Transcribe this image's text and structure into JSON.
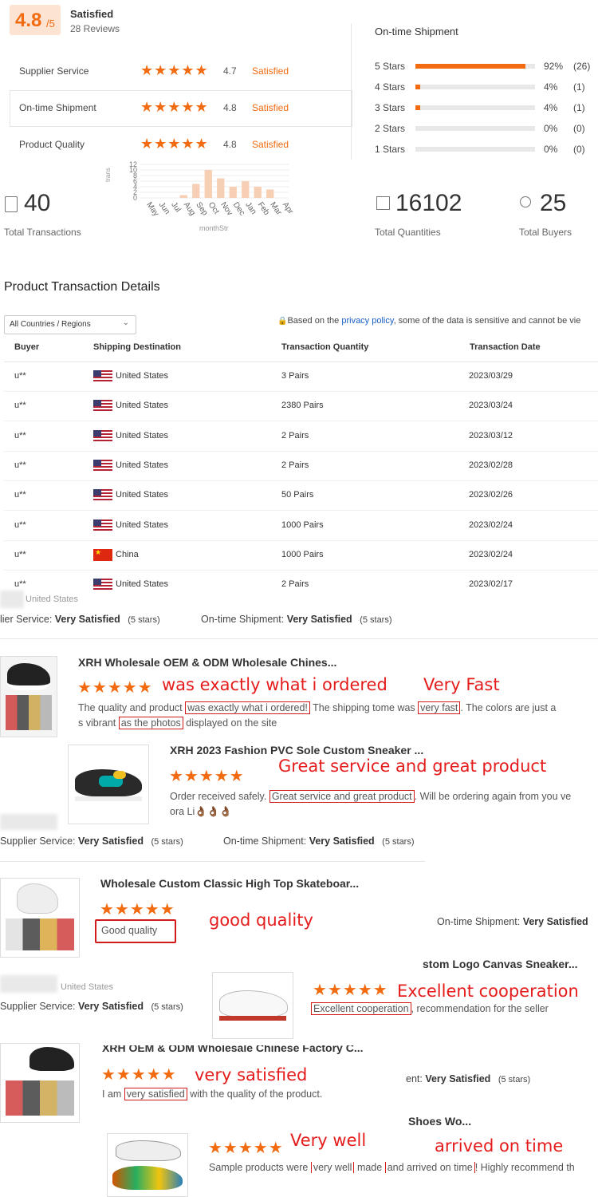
{
  "rating": {
    "score": "4.8",
    "out_of": "/5",
    "label": "Satisfied",
    "reviews": "28 Reviews",
    "items": [
      {
        "label": "Supplier Service",
        "stars": "★★★★★",
        "value": "4.7",
        "status": "Satisfied"
      },
      {
        "label": "On-time Shipment",
        "stars": "★★★★★",
        "value": "4.8",
        "status": "Satisfied"
      },
      {
        "label": "Product Quality",
        "stars": "★★★★★",
        "value": "4.8",
        "status": "Satisfied"
      }
    ]
  },
  "distribution": {
    "title": "On-time Shipment",
    "rows": [
      {
        "label": "5 Stars",
        "fraction": 0.92,
        "pct": "92%",
        "count": "(26)"
      },
      {
        "label": "4 Stars",
        "fraction": 0.04,
        "pct": "4%",
        "count": "(1)"
      },
      {
        "label": "3 Stars",
        "fraction": 0.04,
        "pct": "4%",
        "count": "(1)"
      },
      {
        "label": "2 Stars",
        "fraction": 0,
        "pct": "0%",
        "count": "(0)"
      },
      {
        "label": "1 Stars",
        "fraction": 0,
        "pct": "0%",
        "count": "(0)"
      }
    ]
  },
  "chart_data": {
    "type": "bar",
    "categories": [
      "May",
      "Jun",
      "Jul",
      "Aug",
      "Sep",
      "Oct",
      "Nov",
      "Dec",
      "Jan",
      "Feb",
      "Mar",
      "Apr"
    ],
    "values": [
      0,
      0,
      0,
      1,
      5,
      10,
      7,
      4,
      6,
      4,
      3,
      0
    ],
    "ylabel": "trans",
    "xlabel": "monthStr",
    "yticks": [
      "12",
      "10",
      "8",
      "6",
      "4",
      "2",
      "0"
    ],
    "ylim": [
      0,
      12
    ]
  },
  "stats": {
    "transactions": {
      "value": "40",
      "label": "Total Transactions"
    },
    "quantities": {
      "value": "16102",
      "label": "Total Quantities"
    },
    "buyers": {
      "value": "25",
      "label": "Total Buyers"
    }
  },
  "details": {
    "title": "Product Transaction Details",
    "filter": "All Countries / Regions",
    "notice_pre": "Based on the ",
    "notice_link": "privacy policy",
    "notice_post": ", some of the data is sensitive and cannot be vie",
    "columns": [
      "Buyer",
      "Shipping Destination",
      "Transaction Quantity",
      "Transaction Date"
    ],
    "rows": [
      {
        "buyer": "u**",
        "country": "United States",
        "flag": "us",
        "qty": "3 Pairs",
        "date": "2023/03/29"
      },
      {
        "buyer": "u**",
        "country": "United States",
        "flag": "us",
        "qty": "2380 Pairs",
        "date": "2023/03/24"
      },
      {
        "buyer": "u**",
        "country": "United States",
        "flag": "us",
        "qty": "2 Pairs",
        "date": "2023/03/12"
      },
      {
        "buyer": "u**",
        "country": "United States",
        "flag": "us",
        "qty": "2 Pairs",
        "date": "2023/02/28"
      },
      {
        "buyer": "u**",
        "country": "United States",
        "flag": "us",
        "qty": "50 Pairs",
        "date": "2023/02/26"
      },
      {
        "buyer": "u**",
        "country": "United States",
        "flag": "us",
        "qty": "1000 Pairs",
        "date": "2023/02/24"
      },
      {
        "buyer": "u**",
        "country": "China",
        "flag": "cn",
        "qty": "1000 Pairs",
        "date": "2023/02/24"
      },
      {
        "buyer": "u**",
        "country": "United States",
        "flag": "us",
        "qty": "2 Pairs",
        "date": "2023/02/17"
      }
    ]
  },
  "reviews": {
    "r1_country": "United States",
    "r1_supplier_prefix": "lier Service: ",
    "very_satisfied": "Very Satisfied",
    "five_stars": "(5 stars)",
    "ontime_prefix": "On-time Shipment: ",
    "supplier_prefix": "Supplier Service: ",
    "stars": "★★★★★",
    "p1_title": "XRH Wholesale OEM & ODM Wholesale Chines...",
    "p1_a1": "was exactly what i ordered",
    "p1_a2": "Very Fast",
    "p1_t1": "The quality and product ",
    "p1_b1": "was exactly what i ordered!",
    "p1_t2": " The shipping tome was ",
    "p1_b2": "very fast",
    "p1_t3": ". The colors are just a",
    "p1_t4": "s vibrant ",
    "p1_b3": "as the photos",
    "p1_t5": " displayed on the site",
    "p2_title": "XRH 2023 Fashion PVC Sole Custom Sneaker ...",
    "p2_a1": "Great service and great product",
    "p2_t1": "Order received safely. ",
    "p2_b1": "Great service and great product",
    "p2_t2": ". Will be ordering again from you ve",
    "p2_t3": "ora Li👌🏾👌🏾👌🏾",
    "p3_title": "Wholesale Custom Classic High Top Skateboar...",
    "p3_b1": "Good quality",
    "p3_a1": "good quality",
    "r4_country": "United States",
    "p4_title": "stom Logo Canvas Sneaker...",
    "p4_a1": "Excellent cooperation",
    "p4_b1": "Excellent cooperation",
    "p4_t1": ", recommendation for the seller",
    "p5_title": "XRH OEM & ODM Wholesale Chinese Factory C...",
    "p5_a1": "very satisfied",
    "p5_t1": "I am ",
    "p5_b1": "very satisfied",
    "p5_t2": " with the quality of the product.",
    "p5_side_prefix": "ent: ",
    "p6_title": "Shoes Wo...",
    "p6_a1": "Very well",
    "p6_a2": "arrived on time",
    "p6_t1": "Sample products were ",
    "p6_b1": "very well",
    "p6_t2": " made ",
    "p6_b2": "and arrived on time",
    "p6_t3": "!  Highly recommend th"
  }
}
